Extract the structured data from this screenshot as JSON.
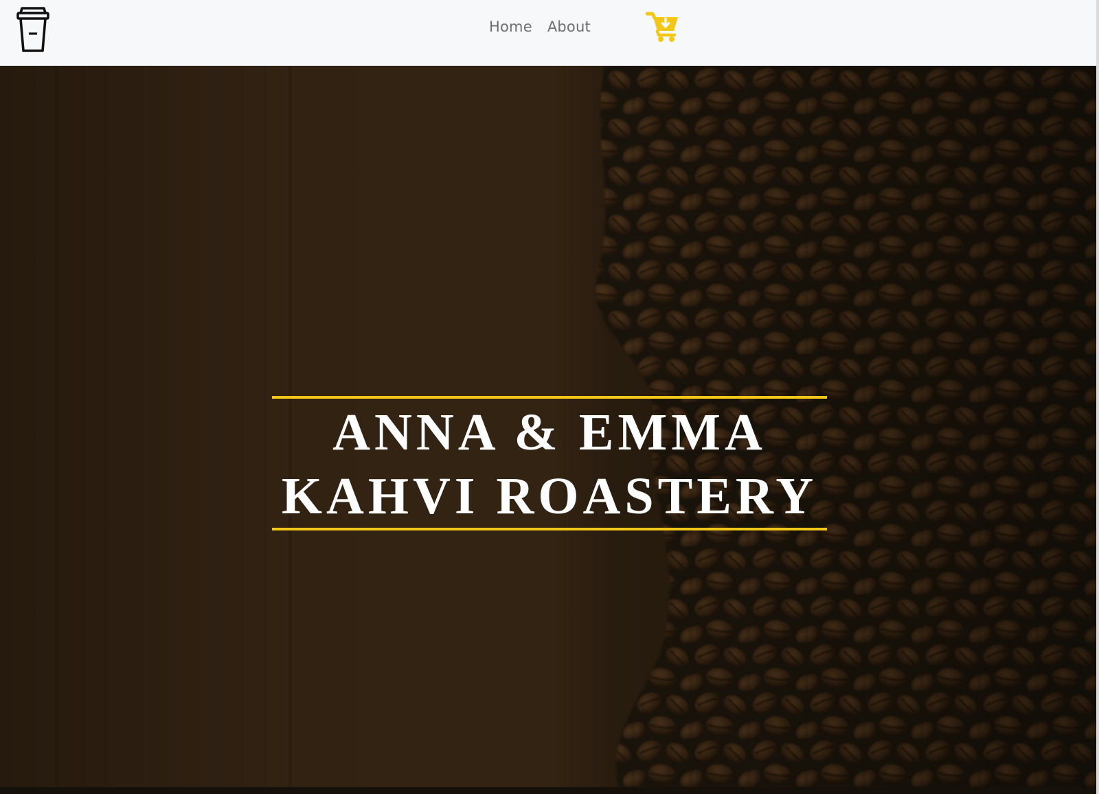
{
  "nav": {
    "logo_icon": "coffee-cup-icon",
    "links": [
      {
        "label": "Home"
      },
      {
        "label": "About"
      }
    ],
    "cart_icon": "shopping-cart-download-icon"
  },
  "hero": {
    "title_line1": "ANNA & EMMA",
    "title_line2": "KAHVI ROASTERY",
    "background": "coffee-beans-photo"
  },
  "colors": {
    "accent": "#f2c718",
    "navbar_bg": "#f7f8fa",
    "hero_bg": "#3a2817",
    "nav_text": "#6e6e6e",
    "title_text": "#ffffff"
  }
}
